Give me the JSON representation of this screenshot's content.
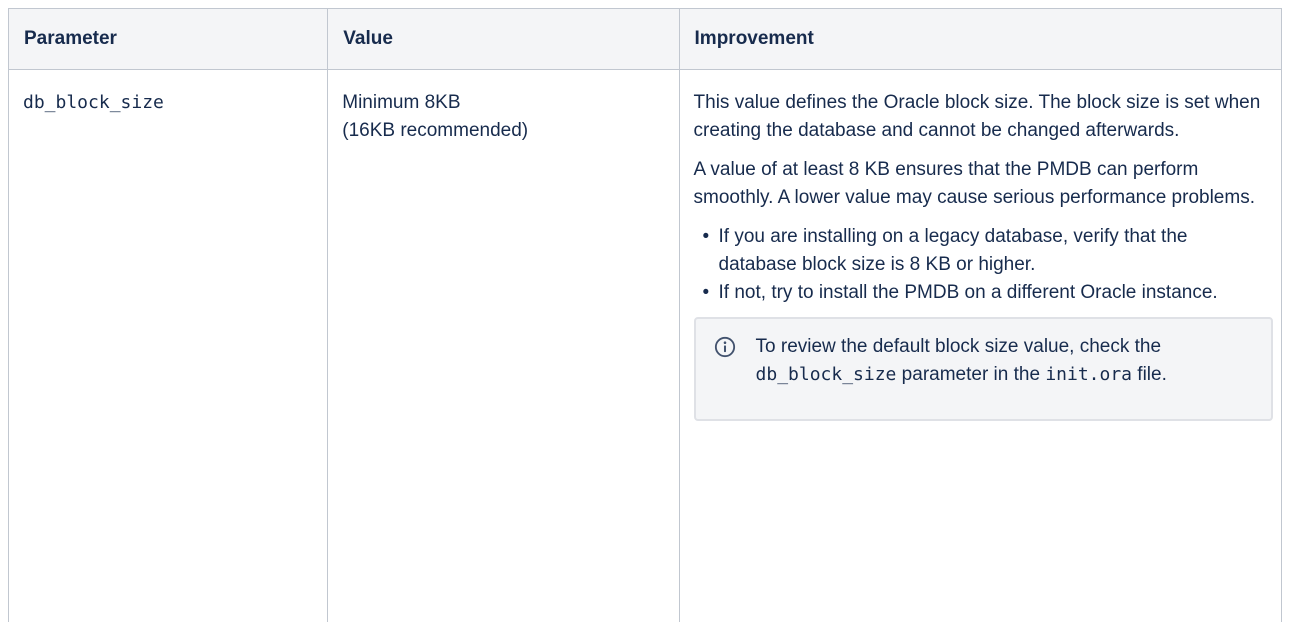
{
  "table": {
    "headers": {
      "parameter": "Parameter",
      "value": "Value",
      "improvement": "Improvement"
    },
    "row": {
      "parameter": "db_block_size",
      "value_line1": "Minimum 8KB",
      "value_line2": "(16KB recommended)",
      "para1": "This value defines the Oracle block size. The block size is set when creating the database and cannot be changed afterwards.",
      "para2": "A value of at least 8 KB ensures that the PMDB can perform smoothly. A lower value may cause serious performance problems.",
      "bullets": [
        "If you are installing on a legacy database, verify that the database block size is 8 KB or higher.",
        "If not, try to install the PMDB on a different Oracle instance."
      ],
      "info": {
        "icon": "info-icon",
        "text_before": "To review the default block size value, check the ",
        "code1": "db_block_size",
        "text_middle": " parameter in the ",
        "code2": "init.ora",
        "text_after": " file."
      }
    }
  },
  "colors": {
    "text": "#172b4d",
    "border": "#c1c7d0",
    "header_bg": "#f4f5f7",
    "info_bg": "#f4f5f7",
    "info_border": "#dfe1e6",
    "info_icon": "#42526e"
  }
}
